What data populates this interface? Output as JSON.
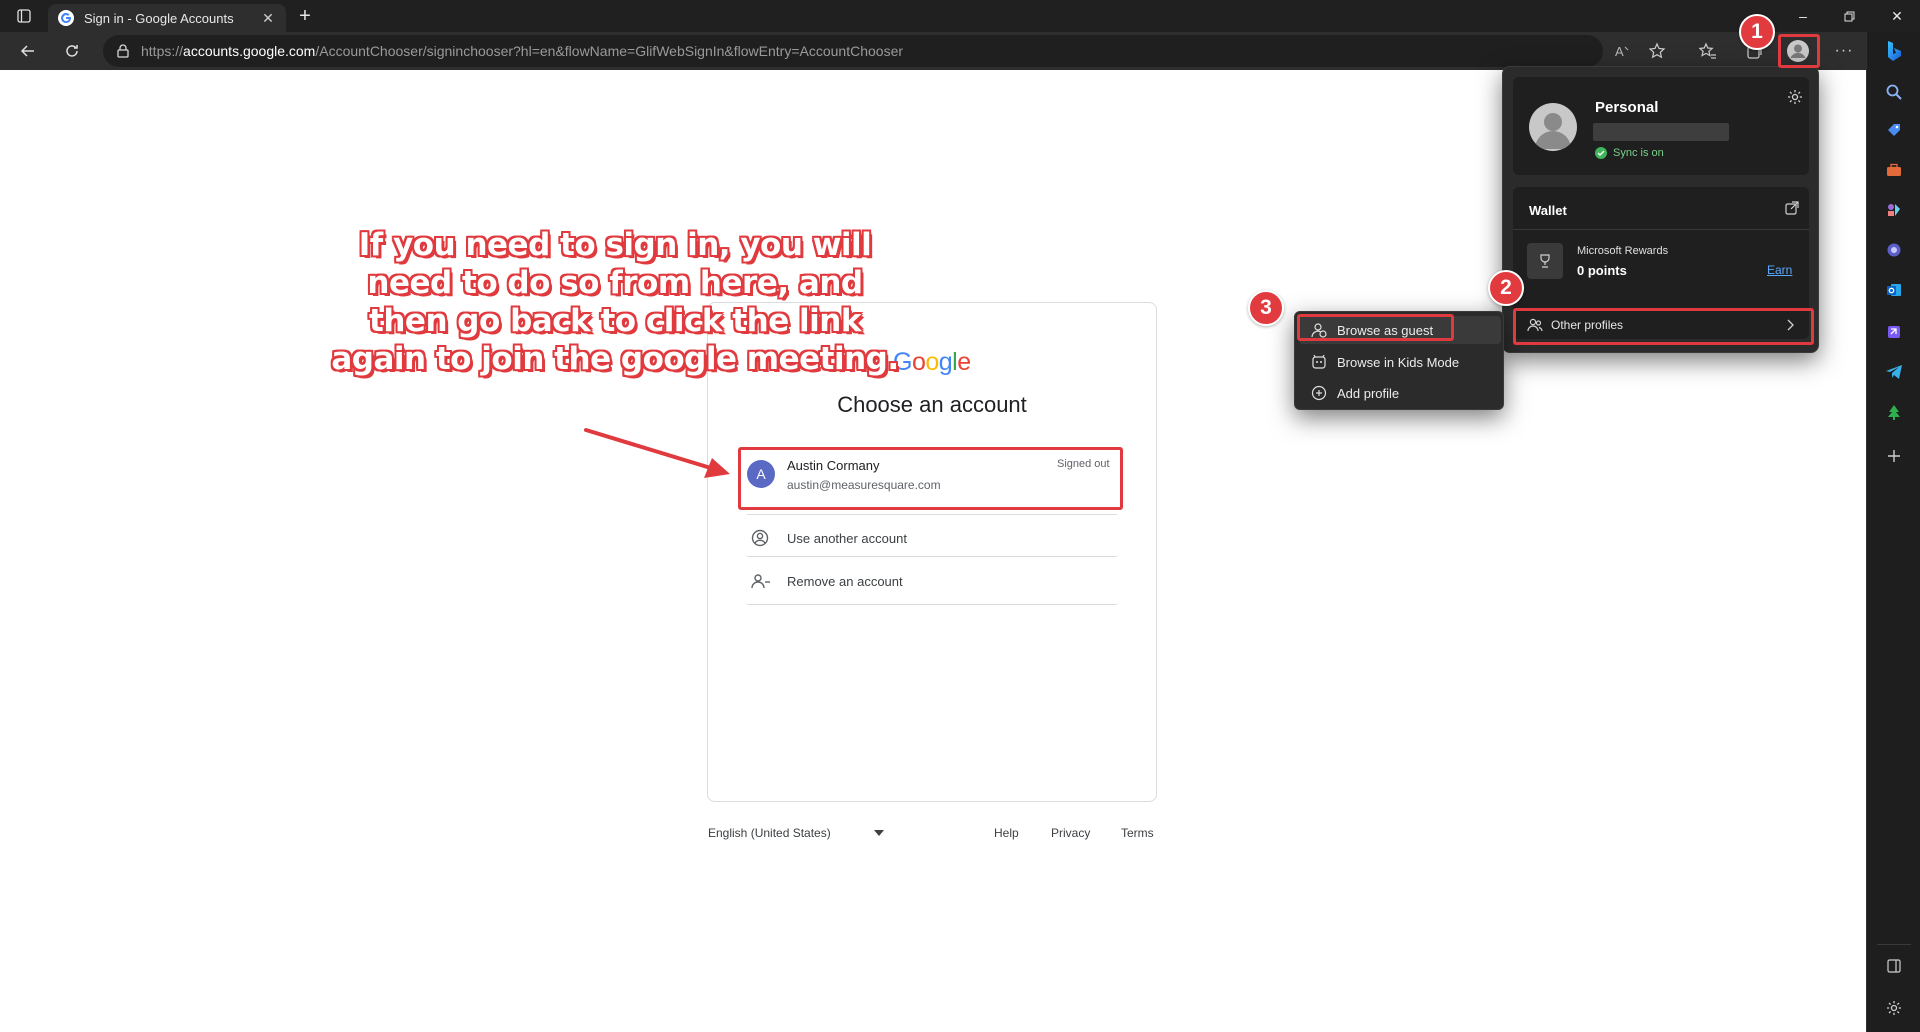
{
  "browser": {
    "tab_title": "Sign in - Google Accounts",
    "tab_close": "✕",
    "new_tab": "+",
    "url_prefix": "https://",
    "url_domain": "accounts.google.com",
    "url_path": "/AccountChooser/signinchooser?hl=en&flowName=GlifWebSignIn&flowEntry=AccountChooser",
    "more_label": "···",
    "window_minimize": "–",
    "window_close": "✕"
  },
  "google": {
    "logo_letters": [
      {
        "ch": "G",
        "color": "#4285F4"
      },
      {
        "ch": "o",
        "color": "#EA4335"
      },
      {
        "ch": "o",
        "color": "#FBBC05"
      },
      {
        "ch": "g",
        "color": "#4285F4"
      },
      {
        "ch": "l",
        "color": "#34A853"
      },
      {
        "ch": "e",
        "color": "#EA4335"
      }
    ],
    "title": "Choose an account",
    "account": {
      "initial": "A",
      "name": "Austin Cormany",
      "email": "austin@measuresquare.com",
      "status": "Signed out"
    },
    "use_another": "Use another account",
    "remove_account": "Remove an account",
    "footer": {
      "language": "English (United States)",
      "help": "Help",
      "privacy": "Privacy",
      "terms": "Terms"
    }
  },
  "profile_flyout": {
    "profile_name": "Personal",
    "sync_status": "Sync is on",
    "wallet_title": "Wallet",
    "rewards_title": "Microsoft Rewards",
    "rewards_points": "0 points",
    "earn_link": "Earn",
    "other_profiles": "Other profiles"
  },
  "submenu": {
    "items": [
      "Browse as guest",
      "Browse in Kids Mode",
      "Add profile"
    ]
  },
  "annotations": {
    "callout_lines": [
      "If you need to sign in, you will",
      "need to do so from here, and",
      "then go back to click the link",
      "again to join the google meeting."
    ],
    "badges": [
      "1",
      "2",
      "3"
    ],
    "highlight_color": "#e03a3e"
  }
}
